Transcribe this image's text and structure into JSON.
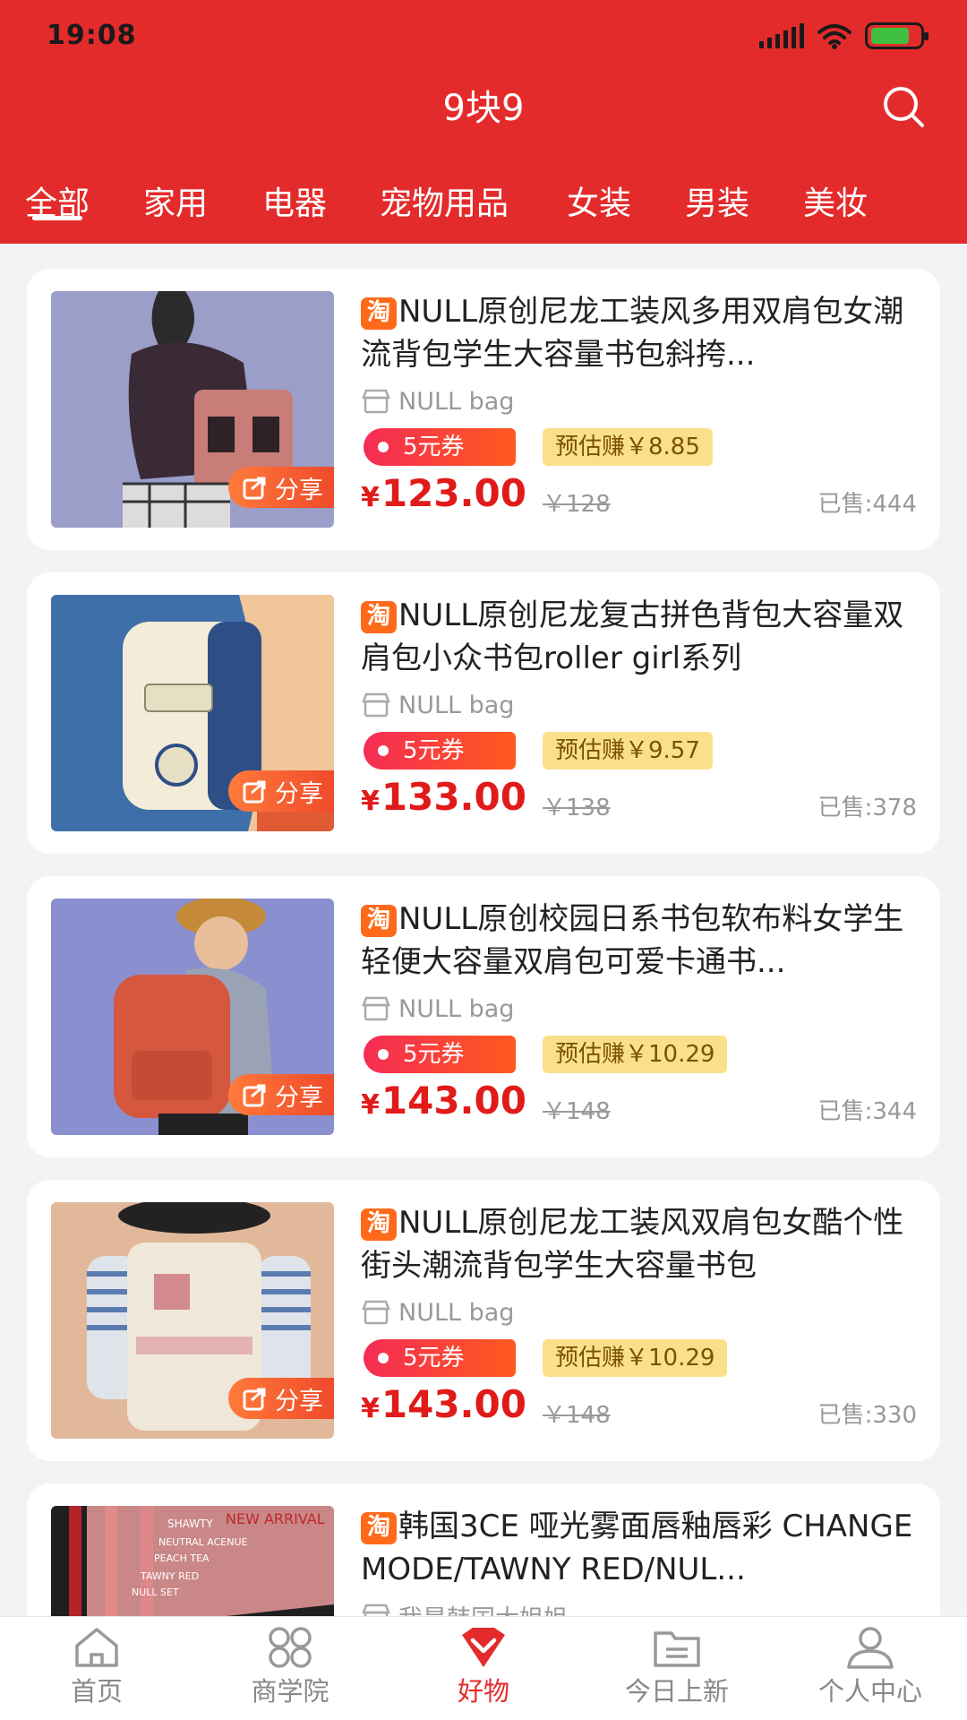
{
  "status": {
    "time": "19:08"
  },
  "header": {
    "title": "9块9"
  },
  "tabs": [
    "全部",
    "家用",
    "电器",
    "宠物用品",
    "女装",
    "男装",
    "美妆"
  ],
  "products": [
    {
      "title": "NULL原创尼龙工装风多用双肩包女潮流背包学生大容量书包斜挎...",
      "shop": "NULL bag",
      "coupon": "5元券",
      "earn": "预估赚￥8.85",
      "price": "123.00",
      "orig": "￥128",
      "sold": "已售:444",
      "share": "分享"
    },
    {
      "title": "NULL原创尼龙复古拼色背包大容量双肩包小众书包roller girl系列",
      "shop": "NULL bag",
      "coupon": "5元券",
      "earn": "预估赚￥9.57",
      "price": "133.00",
      "orig": "￥138",
      "sold": "已售:378",
      "share": "分享"
    },
    {
      "title": "NULL原创校园日系书包软布料女学生轻便大容量双肩包可爱卡通书...",
      "shop": "NULL bag",
      "coupon": "5元券",
      "earn": "预估赚￥10.29",
      "price": "143.00",
      "orig": "￥148",
      "sold": "已售:344",
      "share": "分享"
    },
    {
      "title": "NULL原创尼龙工装风双肩包女酷个性街头潮流背包学生大容量书包",
      "shop": "NULL bag",
      "coupon": "5元券",
      "earn": "预估赚￥10.29",
      "price": "143.00",
      "orig": "￥148",
      "sold": "已售:330",
      "share": "分享"
    },
    {
      "title": "韩国3CE 哑光雾面唇釉唇彩 CHANGE MODE/TAWNY RED/NUL...",
      "shop": "我是韩国大姐姐",
      "thumb_text": [
        "NEW ARRIVAL",
        "SHAWTY",
        "NEUTRAL ACENUE",
        "PEACH TEA",
        "TAWNY RED",
        "NULL SET"
      ]
    }
  ],
  "badge": {
    "tao": "淘",
    "yen": "¥"
  },
  "bottom_nav": [
    "首页",
    "商学院",
    "好物",
    "今日上新",
    "个人中心"
  ],
  "colors": {
    "brand_red": "#e42b2b",
    "price_red": "#e11a1a",
    "earn_bg": "#fbe08a",
    "tao_orange": "#ff6a1a"
  }
}
